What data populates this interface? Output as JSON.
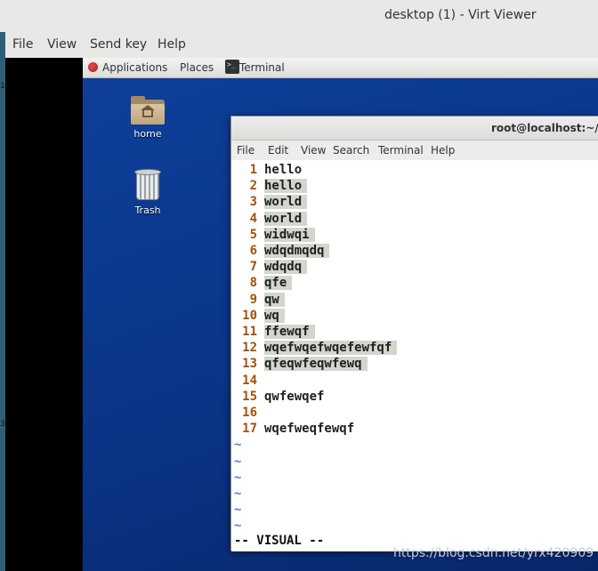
{
  "window": {
    "title": "desktop (1) - Virt Viewer",
    "menu": [
      "File",
      "View",
      "Send key",
      "Help"
    ]
  },
  "host_marks": [
    "1",
    "3"
  ],
  "panel": {
    "applications": "Applications",
    "places": "Places",
    "terminal_task": "Terminal"
  },
  "desktop_icons": {
    "home": "home",
    "trash": "Trash"
  },
  "terminal": {
    "title": "root@localhost:~/De",
    "menu": [
      "File",
      "Edit",
      "View",
      "Search",
      "Terminal",
      "Help"
    ],
    "lines": [
      {
        "num": "1",
        "text": "hello",
        "selected": false
      },
      {
        "num": "2",
        "text": "hello",
        "selected": true
      },
      {
        "num": "3",
        "text": "world",
        "selected": true
      },
      {
        "num": "4",
        "text": "world",
        "selected": true
      },
      {
        "num": "5",
        "text": "widwqi",
        "selected": true
      },
      {
        "num": "6",
        "text": "wdqdmqdq",
        "selected": true
      },
      {
        "num": "7",
        "text": "wdqdq",
        "selected": true
      },
      {
        "num": "8",
        "text": "qfe",
        "selected": true
      },
      {
        "num": "9",
        "text": "qw",
        "selected": true
      },
      {
        "num": "10",
        "text": "wq",
        "selected": true
      },
      {
        "num": "11",
        "text": "ffewqf",
        "selected": true
      },
      {
        "num": "12",
        "text": "wqefwqefwqefewfqf",
        "selected": true
      },
      {
        "num": "13",
        "text": "qfeqwfeqwfewq",
        "selected": true
      },
      {
        "num": "14",
        "text": "",
        "selected": false
      },
      {
        "num": "15",
        "text": "qwfewqef",
        "selected": false
      },
      {
        "num": "16",
        "text": "",
        "selected": false
      },
      {
        "num": "17",
        "text": "wqefweqfewqf",
        "selected": false
      }
    ],
    "tilde": "~",
    "mode": "-- VISUAL --"
  },
  "watermark": "https://blog.csdn.net/yrx420909"
}
